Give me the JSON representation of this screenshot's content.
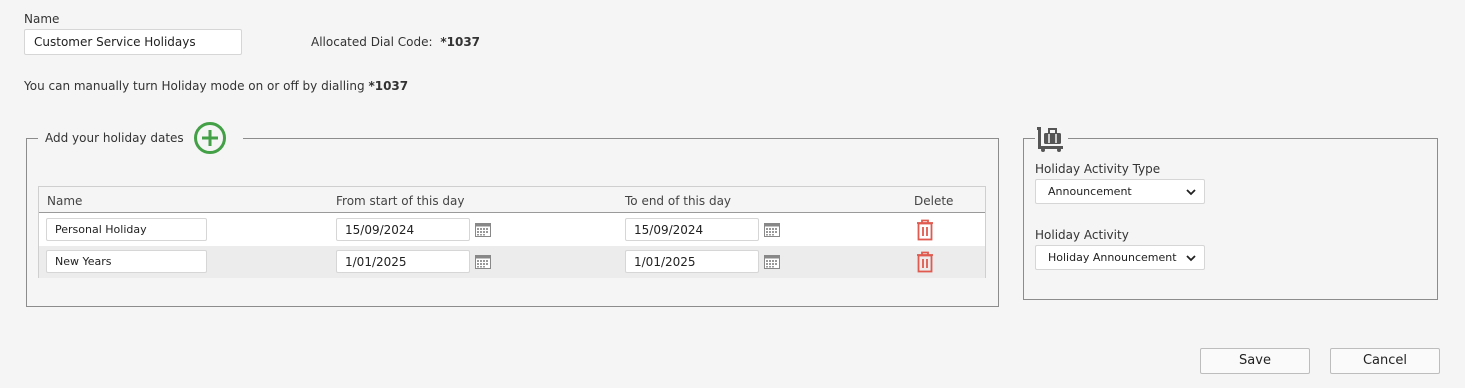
{
  "name_section": {
    "label": "Name",
    "value": "Customer Service Holidays",
    "dial_code_label": "Allocated Dial Code:",
    "dial_code_value": "*1037"
  },
  "manual_note": {
    "text": "You can manually turn Holiday mode on or off by dialling",
    "code": "*1037"
  },
  "holiday_dates": {
    "legend": "Add your holiday dates",
    "add_icon": "plus-circle-icon",
    "accent_color": "#43a047",
    "columns": [
      "Name",
      "From start of this day",
      "To end of this day",
      "Delete"
    ],
    "rows": [
      {
        "name": "Personal Holiday",
        "from": "15/09/2024",
        "to": "15/09/2024"
      },
      {
        "name": "New Years",
        "from": "1/01/2025",
        "to": "1/01/2025"
      }
    ],
    "delete_color": "#e05a4f"
  },
  "activity": {
    "icon": "luggage-cart-icon",
    "type_label": "Holiday Activity Type",
    "type_value": "Announcement",
    "activity_label": "Holiday Activity",
    "activity_value": "Holiday Announcement"
  },
  "buttons": {
    "save": "Save",
    "cancel": "Cancel"
  }
}
